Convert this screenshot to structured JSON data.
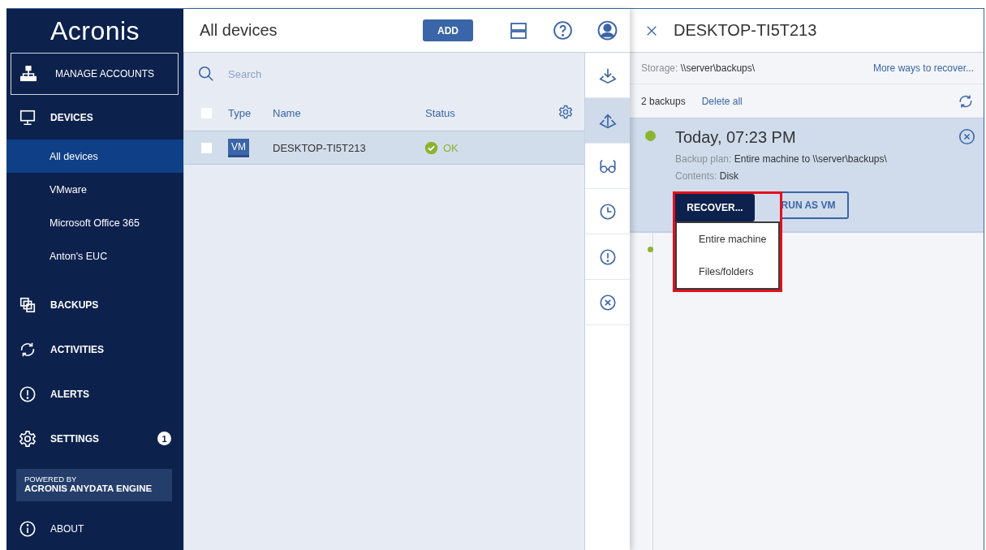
{
  "sidebar": {
    "logo": "Acronis",
    "items": [
      {
        "kind": "account",
        "label": "MANAGE ACCOUNTS",
        "selected": false
      },
      {
        "kind": "section",
        "label": "DEVICES",
        "selected": false
      },
      {
        "kind": "sub",
        "label": "All devices",
        "selected": true
      },
      {
        "kind": "sub",
        "label": "VMware",
        "selected": false
      },
      {
        "kind": "sub",
        "label": "Microsoft Office 365",
        "selected": false
      },
      {
        "kind": "sub",
        "label": "Anton's EUC",
        "selected": false
      },
      {
        "kind": "section",
        "label": "BACKUPS",
        "selected": false
      },
      {
        "kind": "section",
        "label": "ACTIVITIES",
        "selected": false
      },
      {
        "kind": "section",
        "label": "ALERTS",
        "selected": false
      },
      {
        "kind": "section",
        "label": "SETTINGS",
        "selected": false,
        "badge": "1"
      }
    ],
    "powered": {
      "line1": "POWERED BY",
      "line2": "ACRONIS ANYDATA ENGINE"
    },
    "about": "ABOUT"
  },
  "main": {
    "title": "All devices",
    "add_button": "ADD",
    "search": {
      "placeholder": "Search"
    },
    "select_all": {
      "checked": false
    },
    "columns": [
      "Type",
      "Name",
      "Status"
    ],
    "rows": [
      {
        "type": "VM",
        "name": "DESKTOP-TI5T213",
        "status": "OK",
        "status_ok": true,
        "checked": false,
        "selected": true
      }
    ]
  },
  "toolbar": [
    {
      "selected": false
    },
    {
      "selected": true
    },
    {
      "selected": false
    },
    {
      "selected": false
    },
    {
      "selected": false
    },
    {
      "selected": false
    }
  ],
  "panel": {
    "title": "DESKTOP-TI5T213",
    "storage_label": "Storage:",
    "storage_value": "\\\\server\\backups\\",
    "more_link": "More ways to recover...",
    "backup_count": "2 backups",
    "delete_all": "Delete all",
    "backups": [
      {
        "selected": true,
        "time": "Today, 07:23 PM",
        "plan_label": "Backup plan:",
        "plan_value": "Entire machine to \\\\server\\backups\\",
        "contents_label": "Contents:",
        "contents_value": "Disk",
        "buttons": [
          "RUN AS VM"
        ]
      },
      {
        "selected": false
      }
    ],
    "recover_menu": {
      "button": "RECOVER...",
      "items": [
        "Entire machine",
        "Files/folders"
      ]
    }
  }
}
